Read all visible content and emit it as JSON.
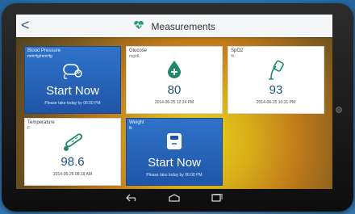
{
  "header": {
    "title": "Measurements",
    "back_label": "<"
  },
  "tiles": {
    "blood_pressure": {
      "name": "Blood Pressure",
      "unit": "mmHg/mmHg",
      "cta": "Start Now",
      "reminder": "Please take today by 06:00 PM"
    },
    "glucose": {
      "name": "Glucose",
      "unit": "mg/dL",
      "value": "80",
      "timestamp": "2014-06-25 12:24 PM"
    },
    "spo2": {
      "name": "SpO2",
      "unit": "%",
      "value": "93",
      "timestamp": "2014-06-25 10:31 PM"
    },
    "temperature": {
      "name": "Temperature",
      "unit": "F",
      "value": "98.6",
      "timestamp": "2014-06-26 08:19 AM"
    },
    "weight": {
      "name": "Weight",
      "unit": "lb",
      "cta": "Start Now",
      "reminder": "Please take today by 06:00 PM"
    }
  },
  "colors": {
    "tile_blue": "#1f55a8",
    "value_blue": "#1e4f84",
    "accent_green": "#1f8a6b"
  },
  "icons": {
    "back": "chevron-left-icon",
    "logo": "heart-logo-icon",
    "blood_pressure": "bp-cuff-icon",
    "glucose": "drop-plus-icon",
    "spo2": "pulse-oximeter-icon",
    "temperature": "thermometer-icon",
    "weight": "scale-icon"
  },
  "navbar": {
    "back": "back-nav-icon",
    "home": "home-nav-icon",
    "recent": "recent-apps-icon"
  }
}
